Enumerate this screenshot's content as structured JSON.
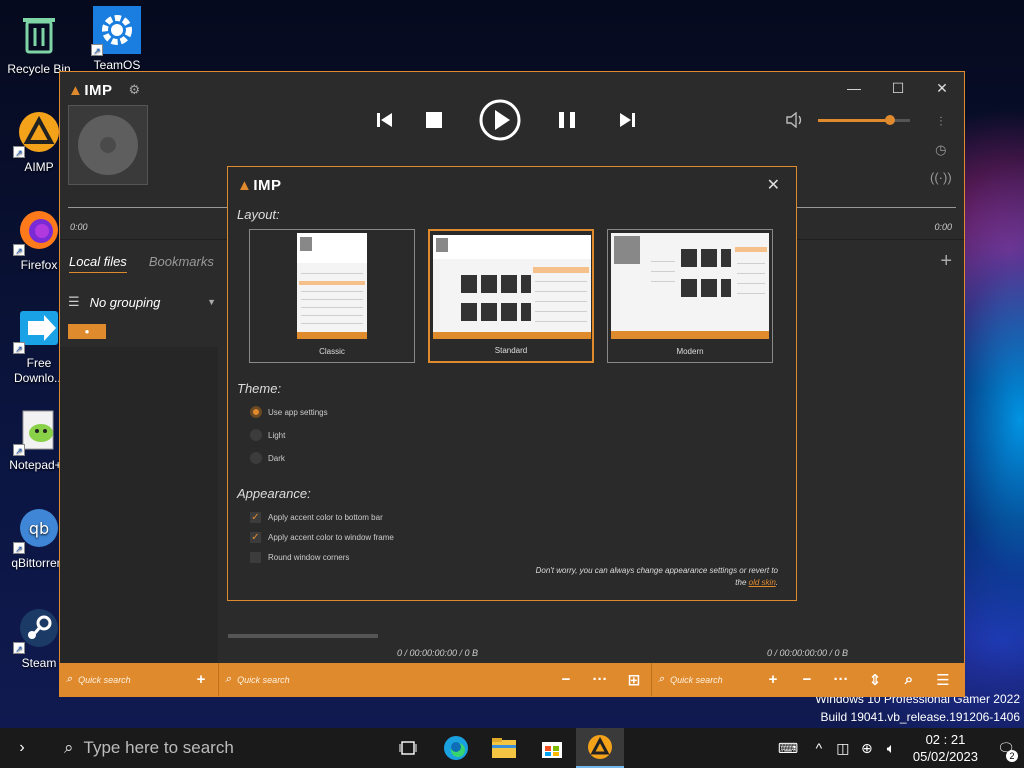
{
  "desktop": {
    "icons": [
      {
        "label": "Recycle Bin",
        "icon": "recycle-bin-icon"
      },
      {
        "label": "TeamOS",
        "icon": "gear-icon"
      },
      {
        "label": "AIMP",
        "icon": "aimp-icon"
      },
      {
        "label": "Firefox",
        "icon": "firefox-icon"
      },
      {
        "label": "Free Downlo...",
        "icon": "download-icon"
      },
      {
        "label": "Notepad++",
        "icon": "notepad-icon"
      },
      {
        "label": "qBittorrent",
        "icon": "qbittorrent-icon"
      },
      {
        "label": "Steam",
        "icon": "steam-icon"
      }
    ],
    "watermark_line1": "Windows 10 Professional Gamer 2022",
    "watermark_line2": "Build 19041.vb_release.191206-1406"
  },
  "taskbar": {
    "search_placeholder": "Type here to search",
    "time": "02 : 21",
    "date": "05/02/2023",
    "notification_count": "2",
    "apps": [
      "task-view-icon",
      "edge-icon",
      "file-explorer-icon",
      "store-icon",
      "aimp-icon"
    ]
  },
  "aimp": {
    "brand": "IMP",
    "time_left": "0:00",
    "time_right": "0:00",
    "tabs": [
      "Local files",
      "Bookmarks"
    ],
    "grouping": "No grouping",
    "status_left": "0 / 00:00:00:00 / 0 B",
    "status_right": "0 / 00:00:00:00 / 0 B",
    "quick_search": "Quick search",
    "volume_level": 0.78,
    "accent": "#e08a2e"
  },
  "dialog": {
    "brand": "IMP",
    "layout_heading": "Layout:",
    "layouts": [
      "Classic",
      "Standard",
      "Modern"
    ],
    "selected_layout": "Standard",
    "theme_heading": "Theme:",
    "themes": [
      "Use app settings",
      "Light",
      "Dark"
    ],
    "selected_theme": "Use app settings",
    "appearance_heading": "Appearance:",
    "appearance": [
      {
        "label": "Apply accent color to bottom bar",
        "checked": true
      },
      {
        "label": "Apply accent color to window frame",
        "checked": true
      },
      {
        "label": "Round window corners",
        "checked": false
      }
    ],
    "note_line1": "Don't worry, you can always change appearance settings or revert to",
    "note_prefix": "the ",
    "note_link": "old skin",
    "note_suffix": "."
  }
}
